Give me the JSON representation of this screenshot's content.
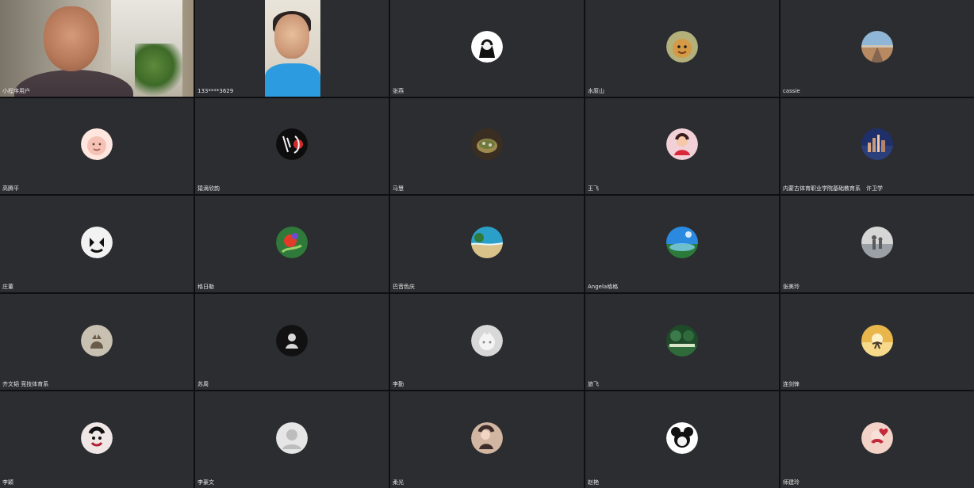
{
  "participants": [
    {
      "name": "小程序用户",
      "type": "video",
      "video": "video-man"
    },
    {
      "name": "133****3629",
      "type": "video",
      "video": "video-woman"
    },
    {
      "name": "张燕",
      "type": "avatar",
      "icon": "woman-portrait-avatar",
      "colors": [
        "#ffffff",
        "#111111"
      ]
    },
    {
      "name": "水原山",
      "type": "avatar",
      "icon": "tiger-toy-avatar",
      "colors": [
        "#b3b07a",
        "#d49a46"
      ]
    },
    {
      "name": "cassie",
      "type": "avatar",
      "icon": "road-landscape-avatar",
      "colors": [
        "#8fb6d6",
        "#b88a62"
      ]
    },
    {
      "name": "高腾平",
      "type": "avatar",
      "icon": "cartoon-face-avatar",
      "colors": [
        "#ffe6de",
        "#e6a69a"
      ]
    },
    {
      "name": "猿滴欣韵",
      "type": "avatar",
      "icon": "calligraphy-art-avatar",
      "colors": [
        "#0d0d0d",
        "#d12a2a"
      ]
    },
    {
      "name": "马慧",
      "type": "avatar",
      "icon": "food-bowl-avatar",
      "colors": [
        "#3a2e23",
        "#9d8a4f"
      ]
    },
    {
      "name": "王飞",
      "type": "avatar",
      "icon": "girl-red-avatar",
      "colors": [
        "#f2d0d7",
        "#d9263a"
      ]
    },
    {
      "name": "内蒙古体育职业学院基础教育系　许卫学",
      "type": "avatar",
      "icon": "city-skyline-avatar",
      "colors": [
        "#1f2f6a",
        "#c79a7a"
      ]
    },
    {
      "name": "庄董",
      "type": "avatar",
      "icon": "marshmello-avatar",
      "colors": [
        "#f2f2f2",
        "#111111"
      ]
    },
    {
      "name": "格日勒",
      "type": "avatar",
      "icon": "red-flower-avatar",
      "colors": [
        "#2f7a3a",
        "#e23b2a"
      ]
    },
    {
      "name": "巴音色庆",
      "type": "avatar",
      "icon": "beach-avatar",
      "colors": [
        "#2aa0c8",
        "#d9c38a"
      ]
    },
    {
      "name": "Angela格格",
      "type": "avatar",
      "icon": "blue-sky-avatar",
      "colors": [
        "#2b8ae0",
        "#2c7a3a"
      ]
    },
    {
      "name": "张美玲",
      "type": "avatar",
      "icon": "people-walking-avatar",
      "colors": [
        "#d6d6d6",
        "#5a5a5a"
      ]
    },
    {
      "name": "齐文韬 竞技体育系",
      "type": "avatar",
      "icon": "cat-avatar",
      "colors": [
        "#c8c1b1",
        "#6b5b4a"
      ]
    },
    {
      "name": "苏周",
      "type": "avatar",
      "icon": "figure-dark-avatar",
      "colors": [
        "#111111",
        "#d8d8d8"
      ]
    },
    {
      "name": "李勤",
      "type": "avatar",
      "icon": "white-cat-avatar",
      "colors": [
        "#d8d8d8",
        "#8a8a8a"
      ]
    },
    {
      "name": "旅飞",
      "type": "avatar",
      "icon": "garden-avatar",
      "colors": [
        "#1f4a2a",
        "#d7e6c7"
      ]
    },
    {
      "name": "连剑锋",
      "type": "avatar",
      "icon": "sunset-avatar",
      "colors": [
        "#e8b64b",
        "#f6d98a"
      ]
    },
    {
      "name": "李颖",
      "type": "avatar",
      "icon": "opera-face-avatar",
      "colors": [
        "#f0e6e6",
        "#b02030"
      ]
    },
    {
      "name": "李豪文",
      "type": "avatar",
      "icon": "default-user-avatar",
      "colors": [
        "#e6e6e6",
        "#bdbdbd"
      ]
    },
    {
      "name": "柔光",
      "type": "avatar",
      "icon": "girl-soft-avatar",
      "colors": [
        "#d2b6a2",
        "#3b2c2a"
      ]
    },
    {
      "name": "赵艳",
      "type": "avatar",
      "icon": "mickey-avatar",
      "colors": [
        "#ffffff",
        "#111111"
      ]
    },
    {
      "name": "师建玲",
      "type": "avatar",
      "icon": "heart-kiss-avatar",
      "colors": [
        "#f3d2c7",
        "#c3283a"
      ]
    }
  ]
}
